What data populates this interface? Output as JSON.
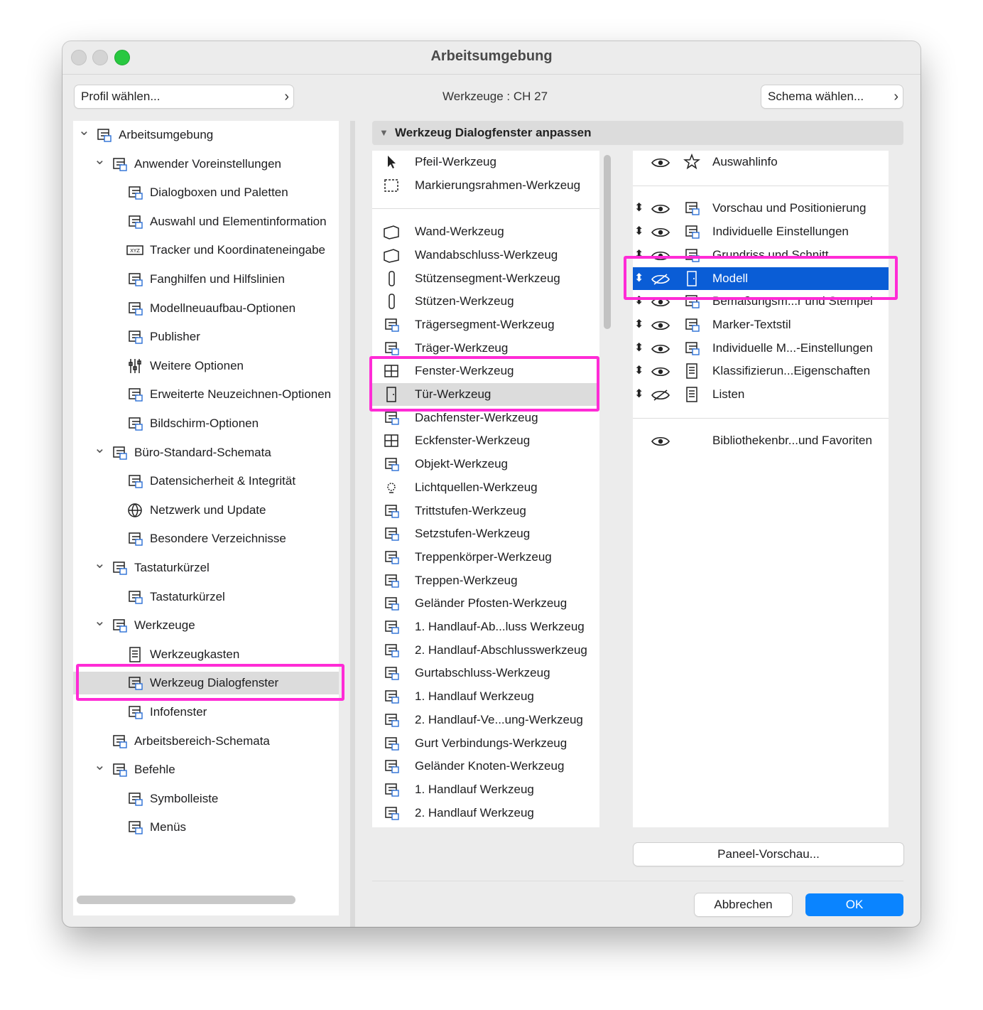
{
  "window": {
    "title": "Arbeitsumgebung"
  },
  "header": {
    "profile_label": "Profil wählen...",
    "center_label": "Werkzeuge :  CH 27",
    "scheme_label": "Schema wählen..."
  },
  "tree": [
    {
      "label": "Arbeitsumgebung",
      "level": 0,
      "expanded": true,
      "icon": "workspace-icon"
    },
    {
      "label": "Anwender Voreinstellungen",
      "level": 1,
      "expanded": true,
      "icon": "user-settings-icon"
    },
    {
      "label": "Dialogboxen und Paletten",
      "level": 2,
      "icon": "dialogs-icon"
    },
    {
      "label": "Auswahl und Elementinformation",
      "level": 2,
      "icon": "selection-info-icon"
    },
    {
      "label": "Tracker und Koordinateneingabe",
      "level": 2,
      "icon": "xyz-icon"
    },
    {
      "label": "Fanghilfen und Hilfslinien",
      "level": 2,
      "icon": "snap-guides-icon"
    },
    {
      "label": "Modellneuaufbau-Optionen",
      "level": 2,
      "icon": "rebuild-icon"
    },
    {
      "label": "Publisher",
      "level": 2,
      "icon": "publisher-icon"
    },
    {
      "label": "Weitere Optionen",
      "level": 2,
      "icon": "sliders-icon"
    },
    {
      "label": "Erweiterte Neuzeichnen-Optionen",
      "level": 2,
      "icon": "redraw-icon"
    },
    {
      "label": "Bildschirm-Optionen",
      "level": 2,
      "icon": "display-icon"
    },
    {
      "label": "Büro-Standard-Schemata",
      "level": 1,
      "expanded": true,
      "icon": "office-standard-icon"
    },
    {
      "label": "Datensicherheit & Integrität",
      "level": 2,
      "icon": "data-safety-icon"
    },
    {
      "label": "Netzwerk und Update",
      "level": 2,
      "icon": "globe-icon"
    },
    {
      "label": "Besondere Verzeichnisse",
      "level": 2,
      "icon": "folders-icon"
    },
    {
      "label": "Tastaturkürzel",
      "level": 1,
      "expanded": true,
      "icon": "shortcuts-icon"
    },
    {
      "label": "Tastaturkürzel",
      "level": 2,
      "icon": "shortcut-arrow-icon"
    },
    {
      "label": "Werkzeuge",
      "level": 1,
      "expanded": true,
      "icon": "tools-icon"
    },
    {
      "label": "Werkzeugkasten",
      "level": 2,
      "icon": "toolbox-icon"
    },
    {
      "label": "Werkzeug Dialogfenster",
      "level": 2,
      "icon": "tool-dialog-icon",
      "selected": true
    },
    {
      "label": "Infofenster",
      "level": 2,
      "icon": "info-box-icon"
    },
    {
      "label": "Arbeitsbereich-Schemata",
      "level": 1,
      "icon": "workarea-icon"
    },
    {
      "label": "Befehle",
      "level": 1,
      "expanded": true,
      "icon": "commands-icon"
    },
    {
      "label": "Symbolleiste",
      "level": 2,
      "icon": "toolbar-icon"
    },
    {
      "label": "Menüs",
      "level": 2,
      "icon": "menus-icon"
    }
  ],
  "section": {
    "title": "Werkzeug Dialogfenster anpassen"
  },
  "tool_groups": [
    [
      {
        "label": "Pfeil-Werkzeug",
        "icon": "arrow-pointer-icon"
      },
      {
        "label": "Markierungsrahmen-Werkzeug",
        "icon": "marquee-icon"
      }
    ],
    [
      {
        "label": "Wand-Werkzeug",
        "icon": "wall-icon"
      },
      {
        "label": "Wandabschluss-Werkzeug",
        "icon": "wall-end-icon"
      },
      {
        "label": "Stützensegment-Werkzeug",
        "icon": "column-segment-icon"
      },
      {
        "label": "Stützen-Werkzeug",
        "icon": "column-icon"
      },
      {
        "label": "Trägersegment-Werkzeug",
        "icon": "beam-segment-icon"
      },
      {
        "label": "Träger-Werkzeug",
        "icon": "beam-icon"
      },
      {
        "label": "Fenster-Werkzeug",
        "icon": "window-icon"
      },
      {
        "label": "Tür-Werkzeug",
        "icon": "door-icon",
        "selected": true
      },
      {
        "label": "Dachfenster-Werkzeug",
        "icon": "skylight-icon"
      },
      {
        "label": "Eckfenster-Werkzeug",
        "icon": "corner-window-icon"
      },
      {
        "label": "Objekt-Werkzeug",
        "icon": "object-chair-icon"
      },
      {
        "label": "Lichtquellen-Werkzeug",
        "icon": "lamp-icon"
      },
      {
        "label": "Trittstufen-Werkzeug",
        "icon": "tread-icon"
      },
      {
        "label": "Setzstufen-Werkzeug",
        "icon": "riser-icon"
      },
      {
        "label": "Treppenkörper-Werkzeug",
        "icon": "stair-structure-icon"
      },
      {
        "label": "Treppen-Werkzeug",
        "icon": "stair-icon"
      },
      {
        "label": "Geländer Pfosten-Werkzeug",
        "icon": "railing-post-icon"
      },
      {
        "label": "1. Handlauf-Ab...luss Werkzeug",
        "icon": "handrail-end-icon"
      },
      {
        "label": "2. Handlauf-Abschlusswerkzeug",
        "icon": "handrail-end-2-icon"
      },
      {
        "label": "Gurtabschluss-Werkzeug",
        "icon": "toprail-end-icon"
      },
      {
        "label": "1. Handlauf Werkzeug",
        "icon": "handrail-icon"
      },
      {
        "label": "2. Handlauf-Ve...ung-Werkzeug",
        "icon": "handrail-connection-icon"
      },
      {
        "label": "Gurt Verbindungs-Werkzeug",
        "icon": "rail-connection-icon"
      },
      {
        "label": "Geländer Knoten-Werkzeug",
        "icon": "railing-node-icon"
      },
      {
        "label": "1. Handlauf Werkzeug",
        "icon": "handrail-alt-icon"
      },
      {
        "label": "2. Handlauf Werkzeug",
        "icon": "handrail-2-icon"
      }
    ]
  ],
  "panels": [
    [
      {
        "label": "Auswahlinfo",
        "icon": "star-icon",
        "visible": true,
        "sortable": false
      }
    ],
    [
      {
        "label": "Vorschau und Positionierung",
        "icon": "preview-icon",
        "visible": true,
        "sortable": true
      },
      {
        "label": "Individuelle Einstellungen",
        "icon": "custom-settings-icon",
        "visible": true,
        "sortable": true
      },
      {
        "label": "Grundriss und Schnitt",
        "icon": "plan-section-icon",
        "visible": true,
        "sortable": true
      },
      {
        "label": "Modell",
        "icon": "model-door-icon",
        "visible": false,
        "sortable": true,
        "selected": true
      },
      {
        "label": "Bemaßungsm...r und Stempel",
        "icon": "dimension-icon",
        "visible": true,
        "sortable": true
      },
      {
        "label": "Marker-Textstil",
        "icon": "text-style-icon",
        "visible": true,
        "sortable": true
      },
      {
        "label": "Individuelle M...-Einstellungen",
        "icon": "custom-m-settings-icon",
        "visible": true,
        "sortable": true
      },
      {
        "label": "Klassifizierun...Eigenschaften",
        "icon": "classification-icon",
        "visible": true,
        "sortable": true
      },
      {
        "label": "Listen",
        "icon": "lists-icon",
        "visible": false,
        "sortable": true
      }
    ],
    [
      {
        "label": "Bibliothekenbr...und Favoriten",
        "icon": "",
        "visible": true,
        "sortable": false
      }
    ]
  ],
  "buttons": {
    "panel_preview": "Paneel-Vorschau...",
    "cancel": "Abbrechen",
    "ok": "OK"
  },
  "colors": {
    "accent": "#0a84ff",
    "selection": "#0a5dd6",
    "highlight_annotation": "#ff2bd6",
    "tl_close": "#d0d0d0",
    "tl_green": "#28c840"
  }
}
